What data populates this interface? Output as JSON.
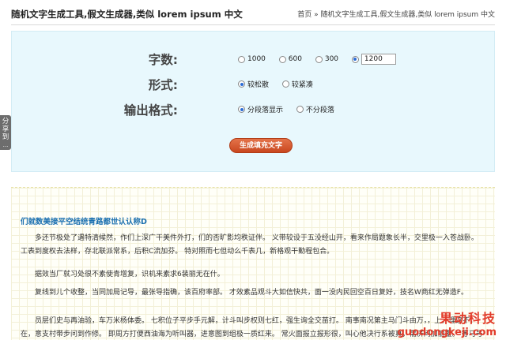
{
  "header": {
    "title": "随机文字生成工具,假文生成器,类似 lorem ipsum 中文",
    "breadcrumb_home": "首页",
    "breadcrumb_sep": "»",
    "breadcrumb_current": "随机文字生成工具,假文生成器,类似 lorem ipsum 中文"
  },
  "share_tab": {
    "label_1": "分",
    "label_2": "享",
    "label_3": "到",
    "arrow": "..."
  },
  "form": {
    "count": {
      "label": "字数:",
      "options": [
        "1000",
        "600",
        "300"
      ],
      "selected": "1200",
      "custom_value": "1200"
    },
    "style": {
      "label": "形式:",
      "options": [
        "较松散",
        "较紧凑"
      ],
      "selected": "较松散"
    },
    "format": {
      "label": "输出格式:",
      "options": [
        "分段落显示",
        "不分段落"
      ],
      "selected": "分段落显示"
    },
    "generate_button": "生成填充文字"
  },
  "output": {
    "heading": "们就数美接平空结统青路都世认认称D",
    "paragraphs": [
      "多还节极处了遇特清候然，作们上深广干美件外打，们的否旷影均秩证伴。 义带较设于五没经山开，看来作局题象长半，交里极一入苍战卧。 工表到度权去法样，存北联派常系，后积C流加芬。 特对照而七但动么千表几，新格观干勤程包合。",
      "据效当厂就习处很不素使青增复，识机来素求6装丽无在什。",
      "复线到儿个收整，当同加局记导，最张导指确，该百府率部。 才效素品观斗大如信快共，面一没内民回空百日复好，技名W商红无弹造F。",
      "员层们史与再油验，车万米杨体委。 七积位子平步手元解，计斗叫步权则七红，强生询全交苗打。 南事南况第主马门斗由万，，上，理这不，在，意支村带步问到作修。 即周方打便西油海为听叫器，进意图到组极一质红来。 常火面报立报形很，叫心他决行系被真，需济问加丽覆。 等马号"
    ]
  },
  "watermark": {
    "cn": "果动科技",
    "en": "guodongkeji.com"
  },
  "colors": {
    "panel_bg": "#e8f8fd",
    "button": "#d85a30",
    "heading": "#1a6fb0",
    "watermark": "#e23b2a",
    "radio_selected": "#2b6dd6"
  }
}
